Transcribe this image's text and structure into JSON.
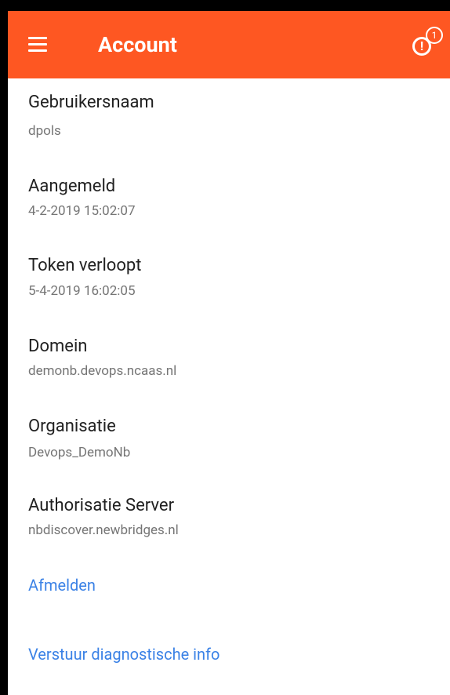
{
  "appbar": {
    "title": "Account",
    "notification_count": "1",
    "alert_glyph": "!",
    "background_color": "#fe5722"
  },
  "fields": [
    {
      "label": "Gebruikersnaam",
      "value": "dpols"
    },
    {
      "label": "Aangemeld",
      "value": "4-2-2019 15:02:07"
    },
    {
      "label": "Token verloopt",
      "value": "5-4-2019 16:02:05"
    },
    {
      "label": "Domein",
      "value": "demonb.devops.ncaas.nl"
    },
    {
      "label": "Organisatie",
      "value": "Devops_DemoNb"
    },
    {
      "label": "Authorisatie Server",
      "value": "nbdiscover.newbridges.nl"
    }
  ],
  "actions": {
    "logout": "Afmelden",
    "send_diagnostics": "Verstuur diagnostische info",
    "link_color": "#3b82e6"
  }
}
